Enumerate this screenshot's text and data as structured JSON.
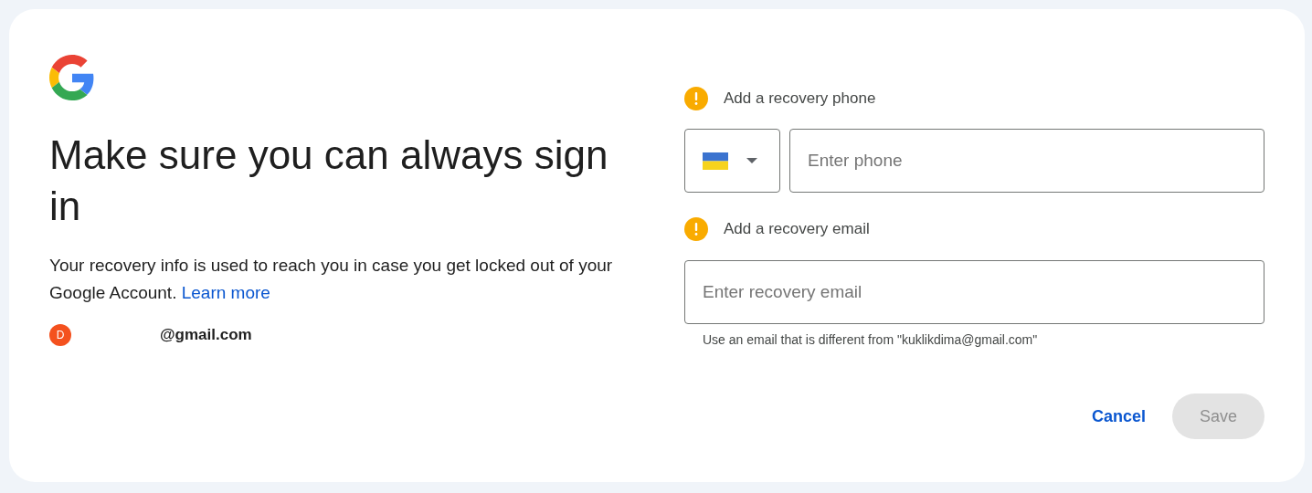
{
  "heading": "Make sure you can always sign in",
  "description": "Your recovery info is used to reach you in case you get locked out of your Google Account.",
  "learn_more_link": "Learn more",
  "account": {
    "avatar_letter": "D",
    "email": "@gmail.com"
  },
  "phone_section": {
    "label": "Add a recovery phone",
    "placeholder": "Enter phone"
  },
  "email_section": {
    "label": "Add a recovery email",
    "placeholder": "Enter recovery email",
    "hint": "Use an email that is different from \"kuklikdima@gmail.com\""
  },
  "buttons": [
    {
      "kind": "text",
      "label": "Cancel",
      "disabled": false
    },
    {
      "kind": "filled",
      "label": "Save",
      "disabled": true
    }
  ]
}
